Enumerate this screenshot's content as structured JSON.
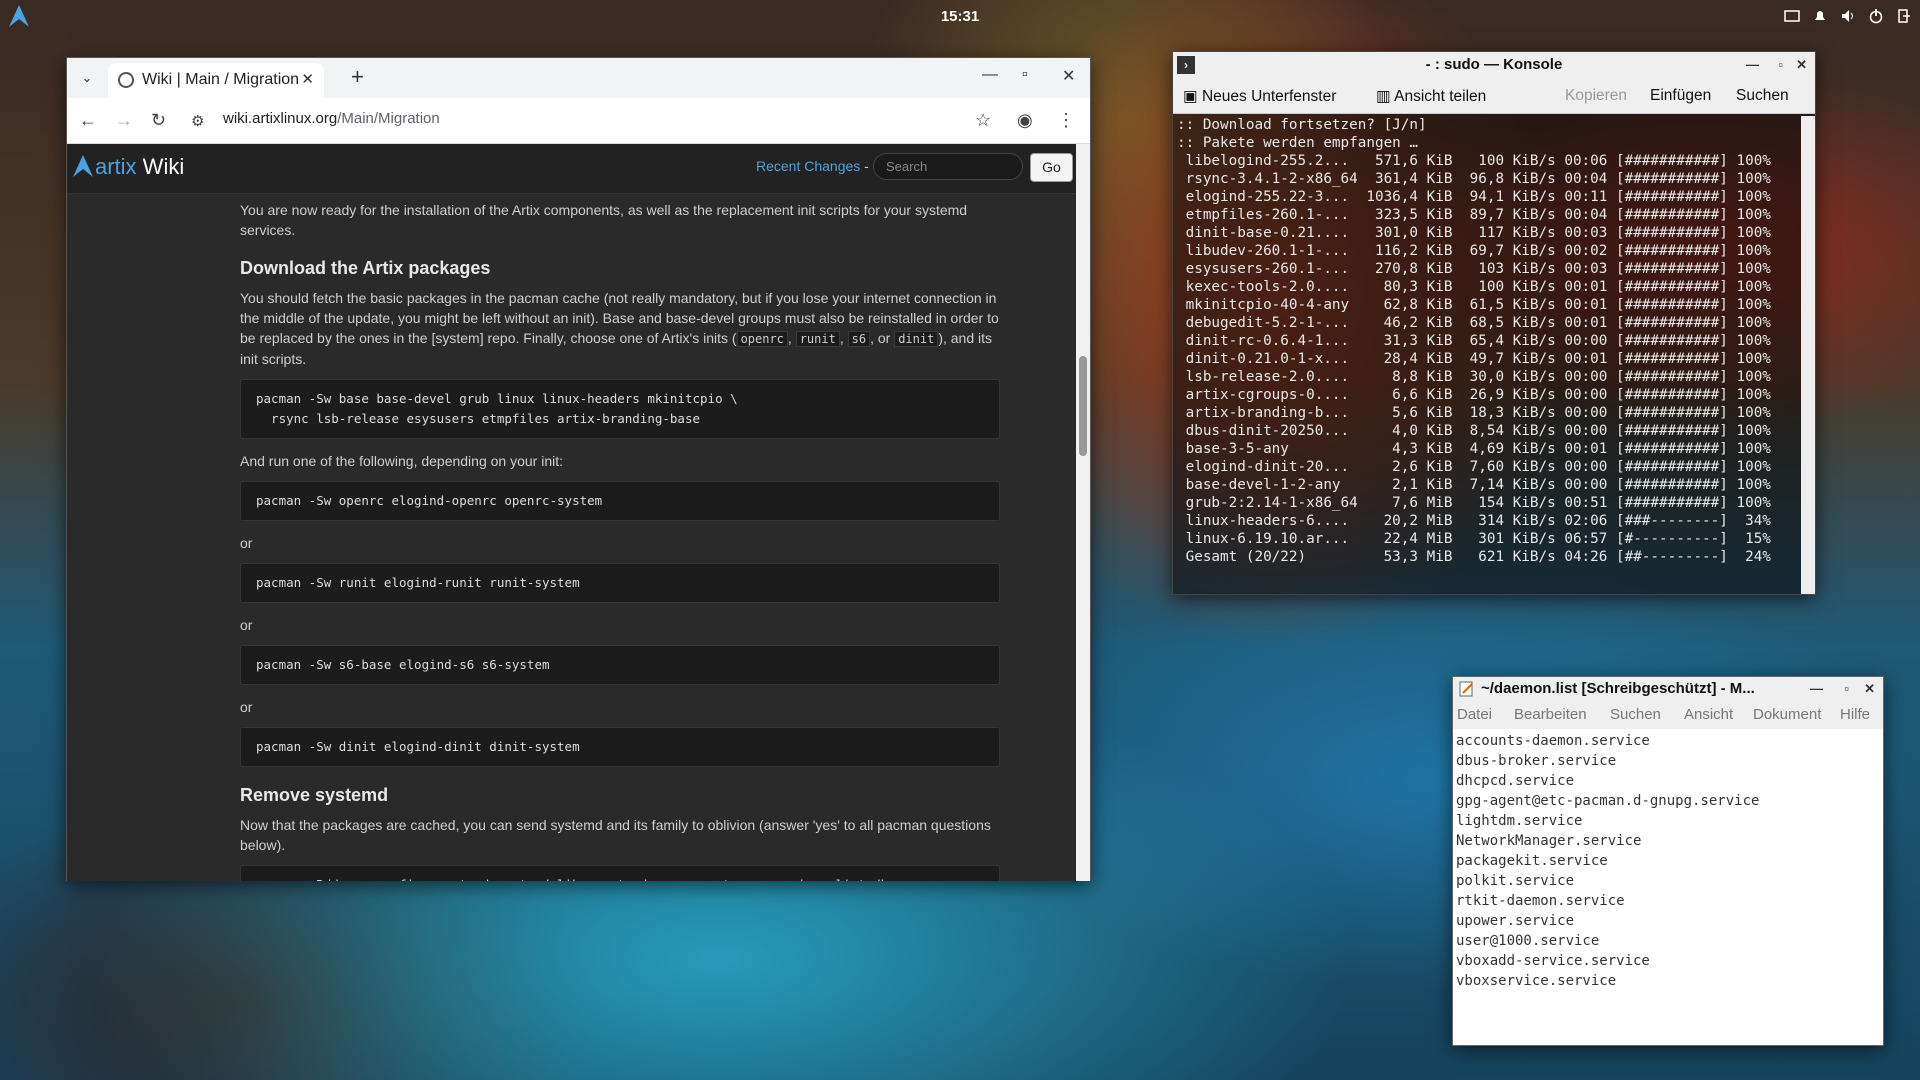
{
  "panel": {
    "clock": "15:31"
  },
  "browser": {
    "tab_title": "Wiki | Main / Migration",
    "url_host": "wiki.artixlinux.org",
    "url_path": "/Main/Migration",
    "wiki": {
      "logo_artix": "artix",
      "logo_wiki": " Wiki",
      "recent_changes": "Recent Changes",
      "recent_sep": " -",
      "search_placeholder": "Search",
      "go": "Go"
    },
    "content": {
      "intro": "You are now ready for the installation of the Artix components, as well as the replacement init scripts for your systemd services.",
      "h_download": "Download the Artix packages",
      "p_download_1": "You should fetch the basic packages in the pacman cache (not really mandatory, but if you lose your internet connection in the middle of the update, you might be left without an init). Base and base-devel groups must also be reinstalled in order to be replaced by the ones in the [system] repo. Finally, choose one of Artix's inits (",
      "init_openrc": "openrc",
      "init_runit": "runit",
      "init_s6": "s6",
      "sep_comma": ", ",
      "sep_or": ", or ",
      "init_dinit": "dinit",
      "p_download_2": "), and its init scripts.",
      "code_base": "pacman -Sw base base-devel grub linux linux-headers mkinitcpio \\\n  rsync lsb-release esysusers etmpfiles artix-branding-base",
      "p_run": "And run one of the following, depending on your init:",
      "code_openrc": "pacman -Sw openrc elogind-openrc openrc-system",
      "or1": "or",
      "code_runit": "pacman -Sw runit elogind-runit runit-system",
      "or2": "or",
      "code_s6": "pacman -Sw s6-base elogind-s6 s6-system",
      "or3": "or",
      "code_dinit": "pacman -Sw dinit elogind-dinit dinit-system",
      "h_remove": "Remove systemd",
      "p_remove": "Now that the packages are cached, you can send systemd and its family to oblivion (answer 'yes' to all pacman questions below).",
      "code_remove": "pacman -Rdd --noconfirm systemd systemd-libs systemd-sysvcompat pacman-mirrorlist dbus\nrm -fv /etc/resolv.conf"
    }
  },
  "konsole": {
    "title": "- : sudo — Konsole",
    "toolbar": {
      "new_split": "Neues Unterfenster",
      "split_view": "Ansicht teilen",
      "copy": "Kopieren",
      "paste": "Einfügen",
      "find": "Suchen"
    },
    "lines": [
      ":: Download fortsetzen? [J/n]",
      ":: Pakete werden empfangen …",
      " libelogind-255.2...   571,6 KiB   100 KiB/s 00:06 [###########] 100%",
      " rsync-3.4.1-2-x86_64  361,4 KiB  96,8 KiB/s 00:04 [###########] 100%",
      " elogind-255.22-3...  1036,4 KiB  94,1 KiB/s 00:11 [###########] 100%",
      " etmpfiles-260.1-...   323,5 KiB  89,7 KiB/s 00:04 [###########] 100%",
      " dinit-base-0.21....   301,0 KiB   117 KiB/s 00:03 [###########] 100%",
      " libudev-260.1-1-...   116,2 KiB  69,7 KiB/s 00:02 [###########] 100%",
      " esysusers-260.1-...   270,8 KiB   103 KiB/s 00:03 [###########] 100%",
      " kexec-tools-2.0....    80,3 KiB   100 KiB/s 00:01 [###########] 100%",
      " mkinitcpio-40-4-any    62,8 KiB  61,5 KiB/s 00:01 [###########] 100%",
      " debugedit-5.2-1-...    46,2 KiB  68,5 KiB/s 00:01 [###########] 100%",
      " dinit-rc-0.6.4-1...    31,3 KiB  65,4 KiB/s 00:00 [###########] 100%",
      " dinit-0.21.0-1-x...    28,4 KiB  49,7 KiB/s 00:01 [###########] 100%",
      " lsb-release-2.0....     8,8 KiB  30,0 KiB/s 00:00 [###########] 100%",
      " artix-cgroups-0....     6,6 KiB  26,9 KiB/s 00:00 [###########] 100%",
      " artix-branding-b...     5,6 KiB  18,3 KiB/s 00:00 [###########] 100%",
      " dbus-dinit-20250...     4,0 KiB  8,54 KiB/s 00:00 [###########] 100%",
      " base-3-5-any            4,3 KiB  4,69 KiB/s 00:01 [###########] 100%",
      " elogind-dinit-20...     2,6 KiB  7,60 KiB/s 00:00 [###########] 100%",
      " base-devel-1-2-any      2,1 KiB  7,14 KiB/s 00:00 [###########] 100%",
      " grub-2:2.14-1-x86_64    7,6 MiB   154 KiB/s 00:51 [###########] 100%",
      " linux-headers-6....    20,2 MiB   314 KiB/s 02:06 [###--------]  34%",
      " linux-6.19.10.ar...    22,4 MiB   301 KiB/s 06:57 [#----------]  15%",
      " Gesamt (20/22)         53,3 MiB   621 KiB/s 04:26 [##---------]  24%"
    ]
  },
  "editor": {
    "title": "~/daemon.list [Schreibgeschützt] - M...",
    "menu": [
      "Datei",
      "Bearbeiten",
      "Suchen",
      "Ansicht",
      "Dokument",
      "Hilfe"
    ],
    "lines": [
      "accounts-daemon.service",
      "dbus-broker.service",
      "dhcpcd.service",
      "gpg-agent@etc-pacman.d-gnupg.service",
      "lightdm.service",
      "NetworkManager.service",
      "packagekit.service",
      "polkit.service",
      "rtkit-daemon.service",
      "upower.service",
      "user@1000.service",
      "vboxadd-service.service",
      "vboxservice.service"
    ]
  }
}
